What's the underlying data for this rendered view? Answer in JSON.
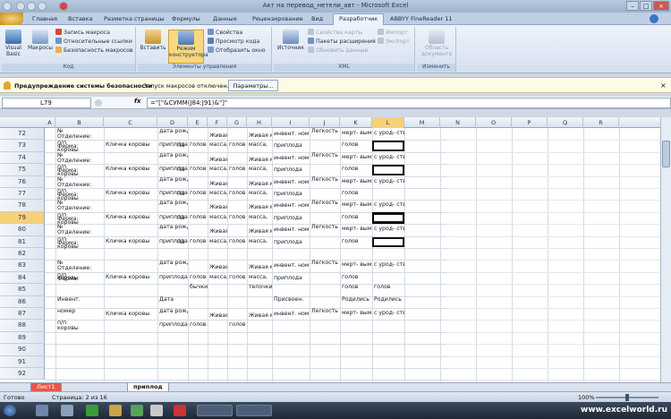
{
  "window": {
    "title": "Акт на перевод_нетели_авт - Microsoft Excel",
    "minimize": "–",
    "maximize": "□",
    "close": "×"
  },
  "tabs": [
    "Главная",
    "Вставка",
    "Разметка страницы",
    "Формулы",
    "Данные",
    "Рецензирование",
    "Вид",
    "Разработчик",
    "ABBYY FineReader 11"
  ],
  "active_tab_index": 7,
  "ribbon": {
    "code": {
      "label": "Код",
      "visual_basic": "Visual Basic",
      "macros": "Макросы",
      "record_macro": "Запись макроса",
      "relative_refs": "Относительные ссылки",
      "macro_security": "Безопасность макросов"
    },
    "controls": {
      "label": "Элементы управления",
      "insert": "Вставить",
      "design_mode": "Режим конструктора",
      "properties": "Свойства",
      "view_code": "Просмотр кода",
      "show_window": "Отобразить окно"
    },
    "xml": {
      "label": "XML",
      "source": "Источник",
      "map_properties": "Свойства карты",
      "expansion_packs": "Пакеты расширения",
      "refresh_data": "Обновить данные",
      "import": "Импорт",
      "export": "Экспорт"
    },
    "modify": {
      "label": "Изменить",
      "document_panel": "Область документа"
    }
  },
  "security_bar": {
    "title": "Предупреждение системы безопасности",
    "message": "Запуск макросов отключен.",
    "button": "Параметры..."
  },
  "formula_bar": {
    "name_box": "L79",
    "fx": "fx",
    "formula": "=\"[\"&СУММ(J84:J91)&\"]\""
  },
  "columns": [
    "A",
    "B",
    "C",
    "D",
    "E",
    "F",
    "G",
    "H",
    "I",
    "J",
    "K",
    "L",
    "M",
    "N",
    "O",
    "P",
    "Q",
    "R"
  ],
  "selected_column": "L",
  "rows": [
    "72",
    "73",
    "74",
    "75",
    "76",
    "77",
    "78",
    "79",
    "80",
    "81",
    "82",
    "83",
    "84",
    "85",
    "86",
    "87",
    "88",
    "89",
    "90",
    "91",
    "92"
  ],
  "selected_row": "79",
  "cells": {
    "no": "№",
    "pp": "п/п",
    "farm": "Ферма:",
    "department": "Отделение:",
    "cow_name": "Кличка коровы",
    "p3": "П3",
    "birth_date": "дата рождения",
    "offspring": "приплода",
    "live_weight": "Живая масса",
    "heads": "голов",
    "mass": "масса,",
    "inv_no": "инвент. номер",
    "offspring_r": "приплода",
    "calving": "Легкость отела",
    "dead": "мерт- выми,",
    "dead_heads": "голов",
    "still": "с урод- ствами,",
    "cows": "коровы",
    "bulls": "бычки",
    "heifers": "телочки",
    "born": "Родились",
    "date": "Дата",
    "inv": "Инвент.",
    "number": "номер",
    "assigned": "Присвоен.",
    "born_heads": "голов"
  },
  "sheets": {
    "first": "Лист1",
    "active": "приплод"
  },
  "status": {
    "ready": "Готово",
    "page": "Страница: 2 из 16",
    "zoom": "100%"
  },
  "watermark": "www.excelworld.ru"
}
